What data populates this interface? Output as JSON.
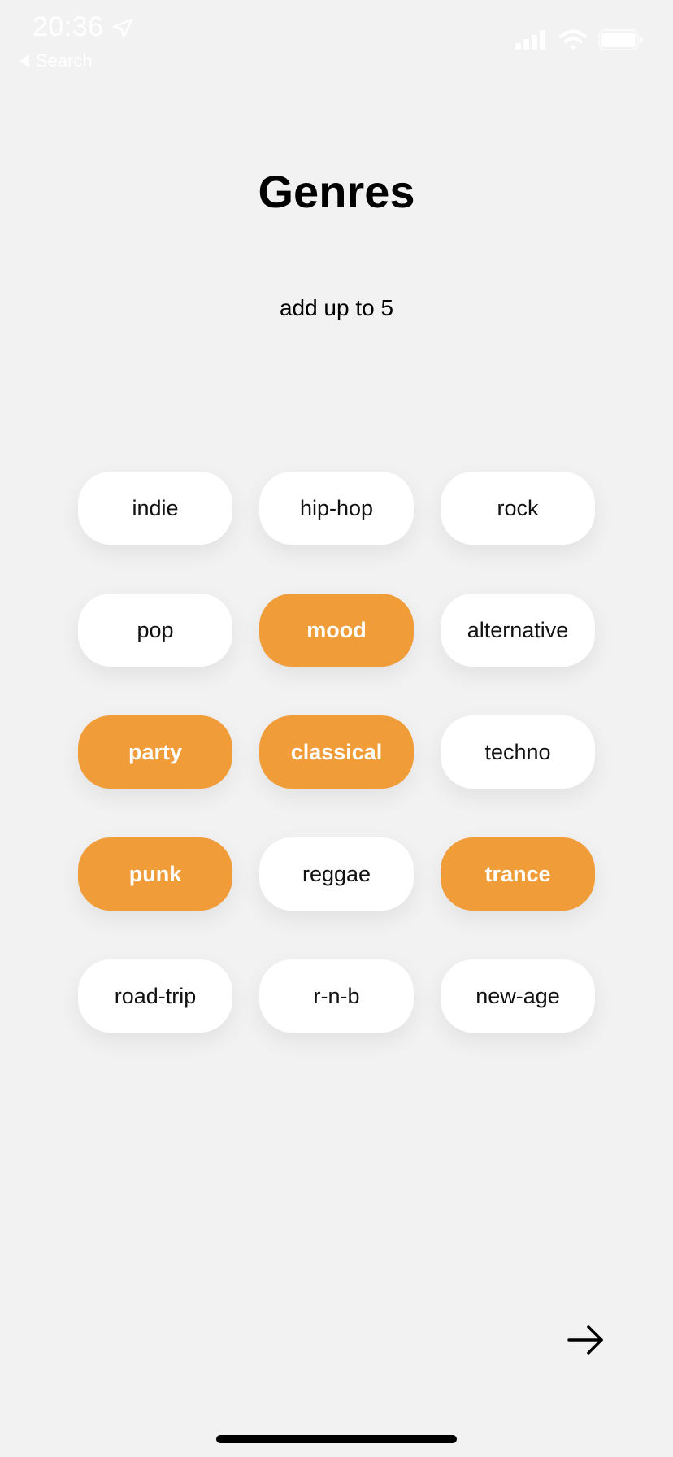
{
  "status_bar": {
    "time": "20:36",
    "back_label": "Search",
    "icons": [
      "location-arrow-icon",
      "cellular-signal-icon",
      "wifi-icon",
      "battery-icon"
    ]
  },
  "header": {
    "title": "Genres",
    "subtitle": "add up to 5"
  },
  "genres": [
    {
      "label": "indie",
      "selected": false
    },
    {
      "label": "hip-hop",
      "selected": false
    },
    {
      "label": "rock",
      "selected": false
    },
    {
      "label": "pop",
      "selected": false
    },
    {
      "label": "mood",
      "selected": true
    },
    {
      "label": "alternative",
      "selected": false
    },
    {
      "label": "party",
      "selected": true
    },
    {
      "label": "classical",
      "selected": true
    },
    {
      "label": "techno",
      "selected": false
    },
    {
      "label": "punk",
      "selected": true
    },
    {
      "label": "reggae",
      "selected": false
    },
    {
      "label": "trance",
      "selected": true
    },
    {
      "label": "road-trip",
      "selected": false
    },
    {
      "label": "r-n-b",
      "selected": false
    },
    {
      "label": "new-age",
      "selected": false
    }
  ],
  "next_button": {
    "icon": "arrow-right-icon"
  },
  "colors": {
    "background": "#f2f2f2",
    "chip": "#ffffff",
    "chip_selected": "#f09c38",
    "text": "#111111"
  }
}
